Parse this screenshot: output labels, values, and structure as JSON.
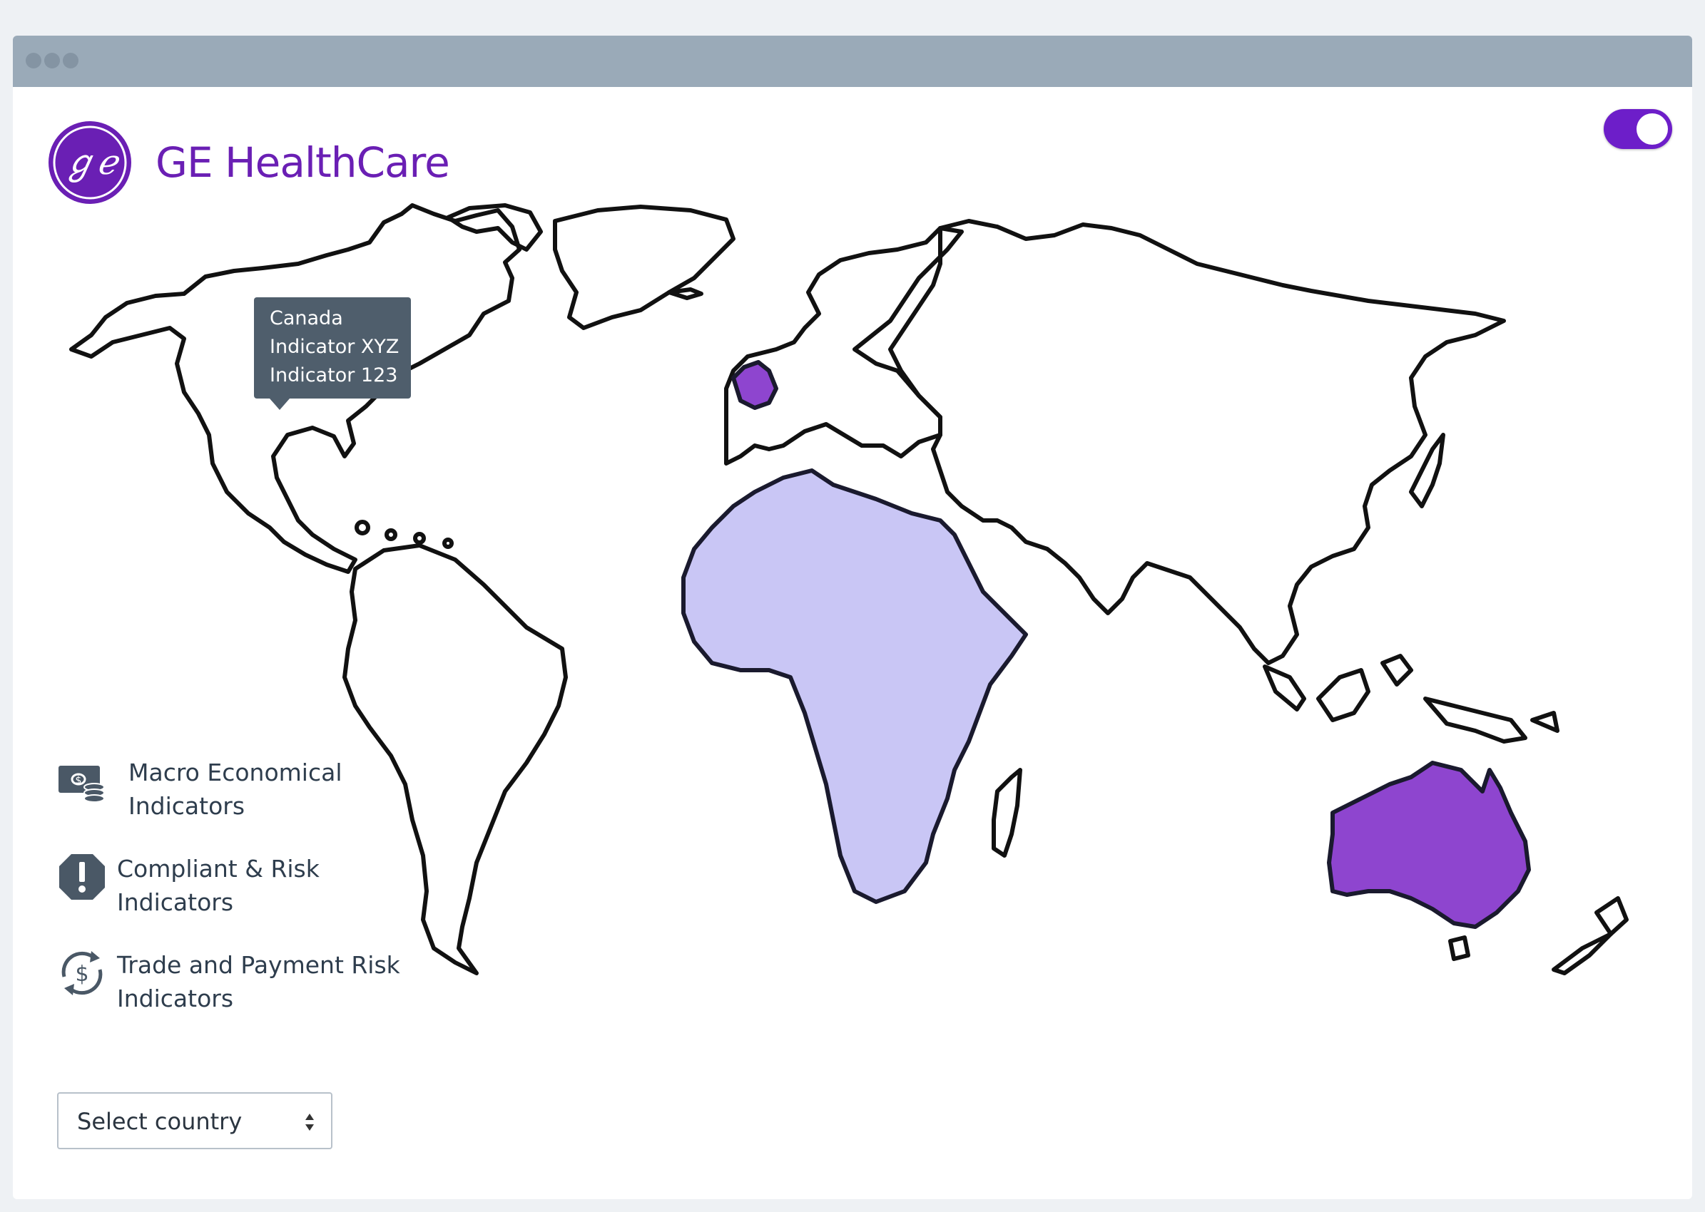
{
  "brand": {
    "name": "GE HealthCare",
    "color": "#6a1fb4"
  },
  "toggle": {
    "state": "on",
    "color": "#6d1ec9"
  },
  "map": {
    "highlighted_regions": [
      {
        "name": "Africa",
        "color": "#c9c6f5"
      },
      {
        "name": "Australia",
        "color": "#8e45cf"
      },
      {
        "name": "United Kingdom",
        "color": "#8e45cf"
      }
    ]
  },
  "tooltip": {
    "lines": [
      "Canada",
      "Indicator XYZ",
      "Indicator 123"
    ]
  },
  "legend": {
    "items": [
      {
        "line1": "Macro Economical",
        "line2": "Indicators",
        "icon": "money-coins-icon"
      },
      {
        "line1": "Compliant & Risk",
        "line2": "Indicators",
        "icon": "alert-octagon-icon"
      },
      {
        "line1": "Trade and Payment Risk",
        "line2": "Indicators",
        "icon": "currency-exchange-icon"
      }
    ]
  },
  "country_select": {
    "placeholder": "Select country"
  }
}
